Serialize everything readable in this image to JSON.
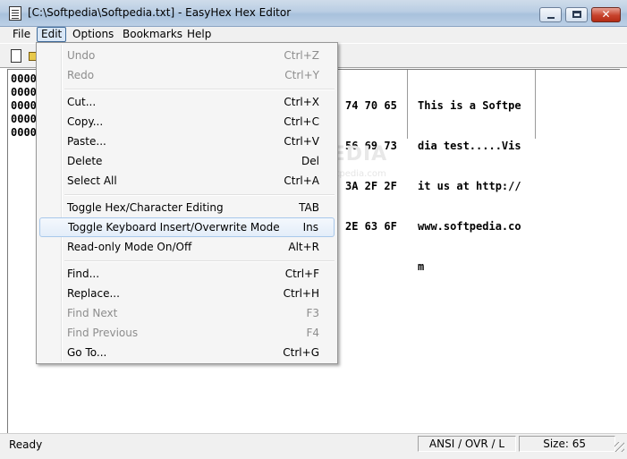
{
  "window": {
    "title": "[C:\\Softpedia\\Softpedia.txt] - EasyHex Hex Editor",
    "close_glyph": "✕"
  },
  "menubar": {
    "file": "File",
    "edit": "Edit",
    "options": "Options",
    "bookmarks": "Bookmarks",
    "help": "Help"
  },
  "editor": {
    "offsets": [
      "0000",
      "0000",
      "0000",
      "0000",
      "0000"
    ],
    "hex_rows": [
      "74 70 65",
      "56 69 73",
      "3A 2F 2F",
      "2E 63 6F",
      ""
    ],
    "ascii_rows": [
      "This is a Softpe",
      "dia test.....Vis",
      "it us at http://",
      "www.softpedia.co",
      "m"
    ]
  },
  "watermark": {
    "text": "SOFTPEDIA",
    "sub": "www.softpedia.com"
  },
  "edit_menu": {
    "items": [
      {
        "label": "Undo",
        "shortcut": "Ctrl+Z",
        "enabled": false
      },
      {
        "label": "Redo",
        "shortcut": "Ctrl+Y",
        "enabled": false
      },
      {
        "label": "Cut...",
        "shortcut": "Ctrl+X",
        "enabled": true
      },
      {
        "label": "Copy...",
        "shortcut": "Ctrl+C",
        "enabled": true
      },
      {
        "label": "Paste...",
        "shortcut": "Ctrl+V",
        "enabled": true
      },
      {
        "label": "Delete",
        "shortcut": "Del",
        "enabled": true
      },
      {
        "label": "Select All",
        "shortcut": "Ctrl+A",
        "enabled": true
      },
      {
        "label": "Toggle Hex/Character Editing",
        "shortcut": "TAB",
        "enabled": true
      },
      {
        "label": "Toggle Keyboard Insert/Overwrite Mode",
        "shortcut": "Ins",
        "enabled": true,
        "highlighted": true
      },
      {
        "label": "Read-only Mode On/Off",
        "shortcut": "Alt+R",
        "enabled": true
      },
      {
        "label": "Find...",
        "shortcut": "Ctrl+F",
        "enabled": true
      },
      {
        "label": "Replace...",
        "shortcut": "Ctrl+H",
        "enabled": true
      },
      {
        "label": "Find Next",
        "shortcut": "F3",
        "enabled": false
      },
      {
        "label": "Find Previous",
        "shortcut": "F4",
        "enabled": false
      },
      {
        "label": "Go To...",
        "shortcut": "Ctrl+G",
        "enabled": true
      }
    ]
  },
  "statusbar": {
    "ready": "Ready",
    "mode": "ANSI / OVR / L",
    "size": "Size: 65"
  }
}
